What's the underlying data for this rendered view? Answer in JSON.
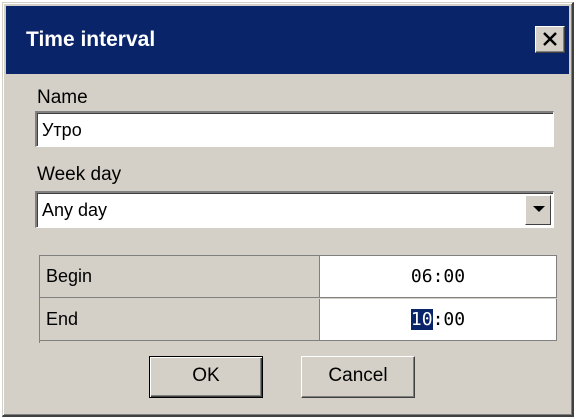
{
  "window": {
    "title": "Time interval",
    "close_icon": "close-icon"
  },
  "name_field": {
    "label": "Name",
    "value": "Утро"
  },
  "week_day": {
    "label": "Week day",
    "selected": "Any day",
    "dropdown_icon": "chevron-down-icon"
  },
  "times": [
    {
      "label": "Begin",
      "value": "06:00"
    },
    {
      "label": "End",
      "hours": "10",
      "rest": ":00"
    }
  ],
  "buttons": {
    "ok": "OK",
    "cancel": "Cancel"
  },
  "colors": {
    "titlebar": "#0a246a",
    "face": "#d4d0c8",
    "selection": "#0a246a"
  }
}
